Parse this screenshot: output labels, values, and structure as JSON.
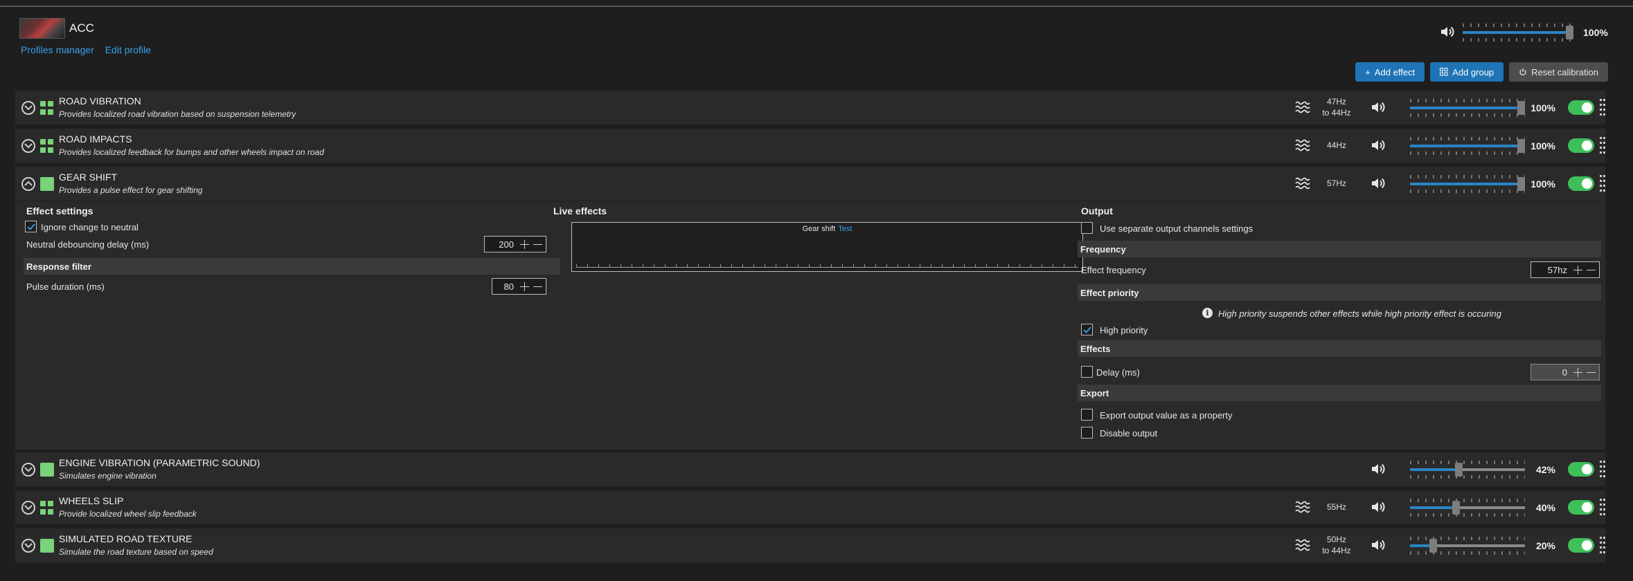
{
  "app": {
    "title": "ACC",
    "links": [
      "Profiles manager",
      "Edit profile"
    ]
  },
  "master": {
    "volume_label": "100%",
    "volume": 100
  },
  "actions": {
    "add_effect": "Add effect",
    "add_group": "Add group",
    "reset_calibration": "Reset calibration"
  },
  "effects": [
    {
      "name": "ROAD VIBRATION",
      "desc": "Provides localized road vibration based on suspension telemetry",
      "freq1": "47Hz",
      "freq2": "to 44Hz",
      "volume_label": "100%",
      "volume": 100,
      "icon": "grid"
    },
    {
      "name": "ROAD IMPACTS",
      "desc": "Provides localized feedback for bumps and other wheels impact on road",
      "freq1": "44Hz",
      "freq2": "",
      "volume_label": "100%",
      "volume": 100,
      "icon": "grid"
    },
    {
      "name": "GEAR SHIFT",
      "desc": "Provides a pulse effect for gear shifting",
      "freq1": "57Hz",
      "freq2": "",
      "volume_label": "100%",
      "volume": 100,
      "icon": "single"
    },
    {
      "name": "ENGINE VIBRATION (PARAMETRIC SOUND)",
      "desc": "Simulates engine vibration",
      "freq1": "",
      "freq2": "",
      "volume_label": "42%",
      "volume": 42,
      "icon": "single"
    },
    {
      "name": "WHEELS SLIP",
      "desc": "Provide localized wheel slip feedback",
      "freq1": "55Hz",
      "freq2": "",
      "volume_label": "40%",
      "volume": 40,
      "icon": "grid"
    },
    {
      "name": "SIMULATED ROAD TEXTURE",
      "desc": "Simulate the road texture based on speed",
      "freq1": "50Hz",
      "freq2": "to 44Hz",
      "volume_label": "20%",
      "volume": 20,
      "icon": "single"
    }
  ],
  "panel": {
    "effect_settings": {
      "title": "Effect settings",
      "ignore_neutral": "Ignore change to neutral",
      "debounce_label": "Neutral debouncing delay (ms)",
      "debounce_value": "200",
      "response_filter": "Response filter",
      "pulse_label": "Pulse duration (ms)",
      "pulse_value": "80"
    },
    "live": {
      "title": "Live effects",
      "name": "Gear shift",
      "test": "Test"
    },
    "output": {
      "title": "Output",
      "separate": "Use separate output channels settings",
      "frequency": "Frequency",
      "effect_frequency": "Effect frequency",
      "effect_frequency_value": "57hz",
      "priority": "Effect priority",
      "priority_info": "High priority suspends other effects while high priority effect is occuring",
      "high_priority": "High priority",
      "effects": "Effects",
      "delay": "Delay (ms)",
      "delay_value": "0",
      "export": "Export",
      "export_value": "Export output value as a property",
      "disable_output": "Disable output"
    }
  }
}
